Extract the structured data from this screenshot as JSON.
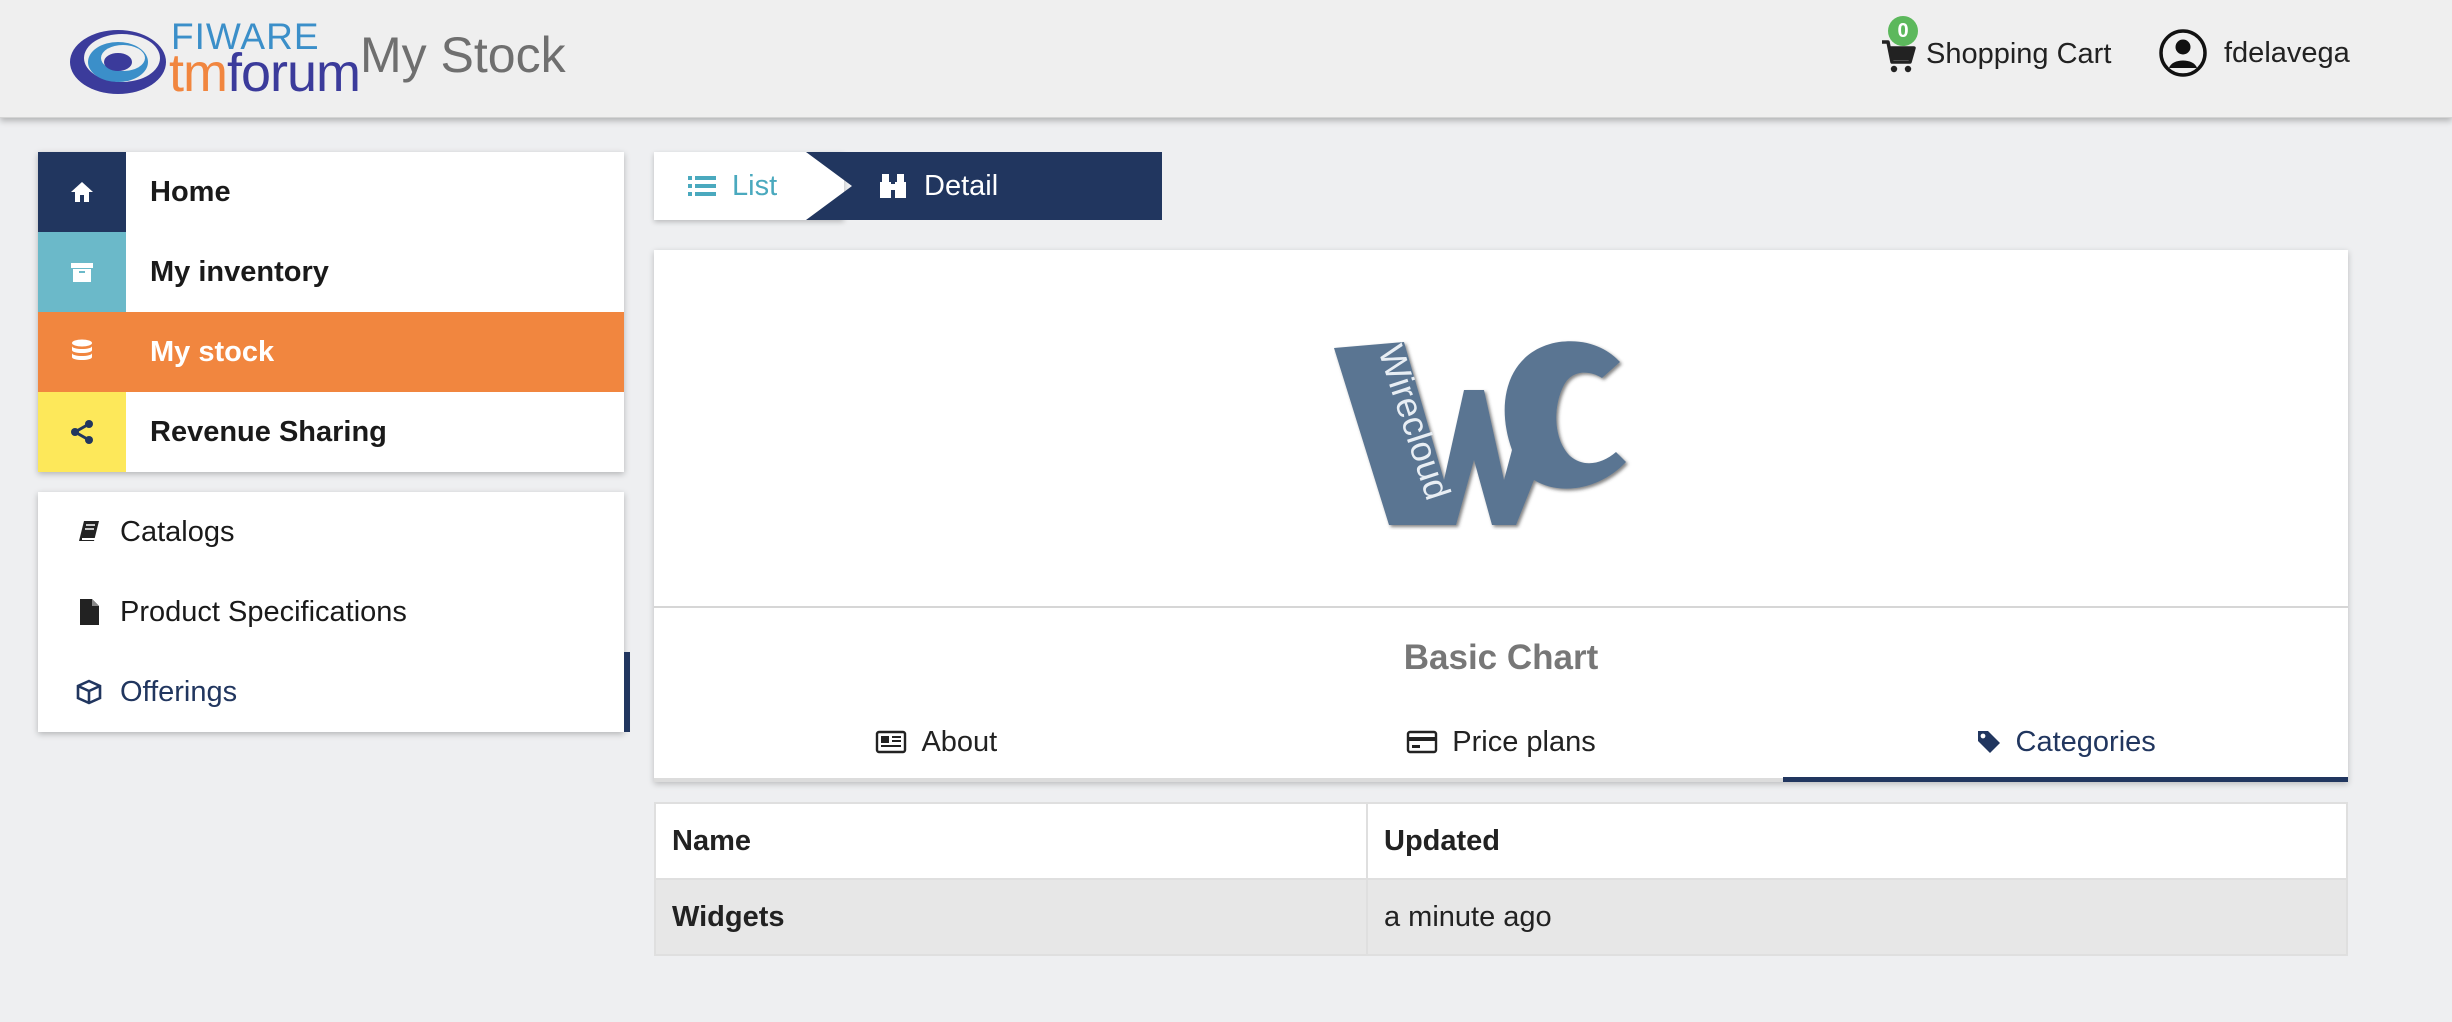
{
  "header": {
    "logo": {
      "fiware": "FIWARE",
      "tm": "tm",
      "forum": "forum"
    },
    "title": "My Stock",
    "cart": {
      "count": "0",
      "label": "Shopping Cart"
    },
    "user": {
      "name": "fdelavega"
    }
  },
  "sidebar": {
    "primary": [
      {
        "label": "Home",
        "icon": "home-icon",
        "color": "#21365f"
      },
      {
        "label": "My inventory",
        "icon": "archive-icon",
        "color": "#6bb9c9"
      },
      {
        "label": "My stock",
        "icon": "database-icon",
        "color": "#f1863f",
        "active": true
      },
      {
        "label": "Revenue Sharing",
        "icon": "share-icon",
        "color": "#fde85a"
      }
    ],
    "secondary": [
      {
        "label": "Catalogs",
        "icon": "book-icon"
      },
      {
        "label": "Product Specifications",
        "icon": "file-icon"
      },
      {
        "label": "Offerings",
        "icon": "cube-icon",
        "active": true
      }
    ]
  },
  "breadcrumb": {
    "list": "List",
    "detail": "Detail"
  },
  "product": {
    "logo_text": "Wirecloud",
    "name": "Basic Chart",
    "tabs": [
      {
        "label": "About",
        "icon": "newspaper-icon"
      },
      {
        "label": "Price plans",
        "icon": "credit-card-icon"
      },
      {
        "label": "Categories",
        "icon": "tag-icon",
        "active": true
      }
    ]
  },
  "categories_table": {
    "headers": [
      "Name",
      "Updated"
    ],
    "rows": [
      {
        "name": "Widgets",
        "updated": "a minute ago"
      }
    ]
  },
  "colors": {
    "primary": "#21365f",
    "accent": "#f1863f",
    "teal": "#4aa9be"
  }
}
